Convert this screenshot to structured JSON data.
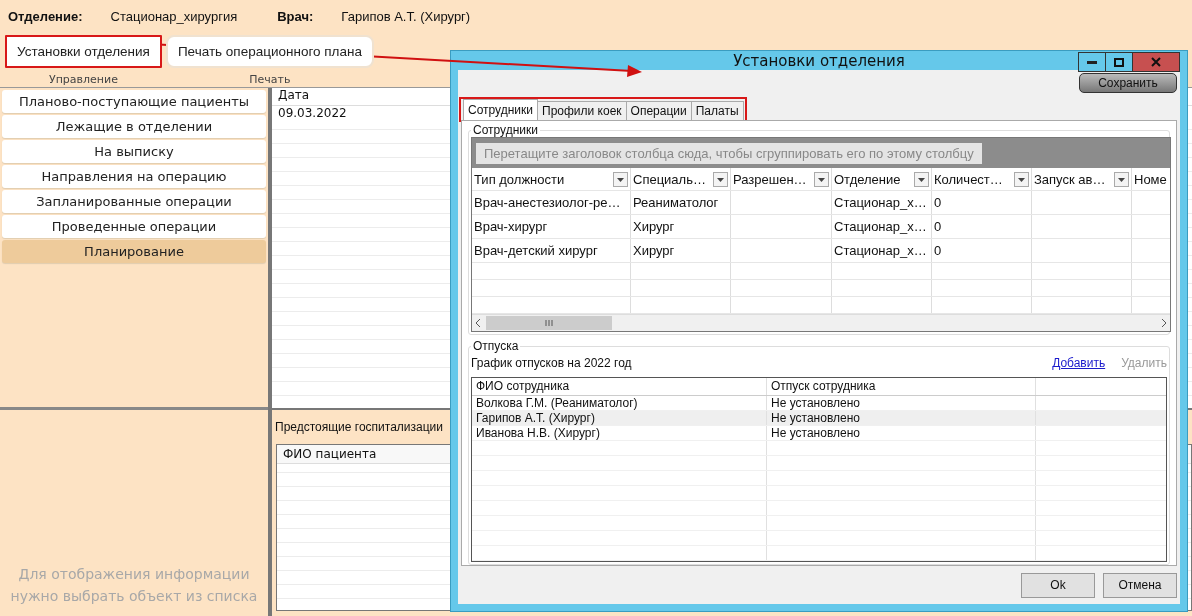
{
  "header": {
    "department_label": "Отделение:",
    "department": "Стационар_хирургия",
    "doctor_label": "Врач:",
    "doctor": "Гарипов А.Т. (Хирург)"
  },
  "ribbon": [
    {
      "group": "Управление",
      "button": "Установки отделения",
      "highlighted": true
    },
    {
      "group": "Печать",
      "button": "Печать операционного плана",
      "highlighted": false
    }
  ],
  "nav": [
    {
      "label": "Планово-поступающие пациенты",
      "selected": false
    },
    {
      "label": "Лежащие в отделении",
      "selected": false
    },
    {
      "label": "На выписку",
      "selected": false
    },
    {
      "label": "Направления на операцию",
      "selected": false
    },
    {
      "label": "Запланированные операции",
      "selected": false
    },
    {
      "label": "Проведенные операции",
      "selected": false
    },
    {
      "label": "Планирование",
      "selected": true
    }
  ],
  "empty_hint": "Для отображения информации нужно выбрать объект из списка",
  "date_grid": {
    "column": "Дата",
    "rows": [
      "09.03.2022"
    ]
  },
  "hospitalizations": {
    "title": "Предстоящие госпитализации",
    "column": "ФИО пациента"
  },
  "dialog": {
    "title": "Установки отделения",
    "save_button": "Сохранить",
    "tabs_highlighted": true,
    "tabs": [
      {
        "label": "Сотрудники",
        "selected": true
      },
      {
        "label": "Профили коек",
        "selected": false
      },
      {
        "label": "Операции",
        "selected": false
      },
      {
        "label": "Палаты",
        "selected": false
      }
    ],
    "staff": {
      "title": "Сотрудники",
      "group_hint": "Перетащите заголовок столбца сюда, чтобы сгруппировать его по этому столбцу",
      "columns": [
        "Тип должности",
        "Специаль…",
        "Разрешен…",
        "Отделение",
        "Количест…",
        "Запуск ав…",
        "Номе"
      ],
      "rows": [
        [
          "Врач-анестезиолог-ре…",
          "Реаниматолог",
          "",
          "Стационар_х…",
          "0",
          "",
          ""
        ],
        [
          "Врач-хирург",
          "Хирург",
          "",
          "Стационар_х…",
          "0",
          "",
          ""
        ],
        [
          "Врач-детский хирург",
          "Хирург",
          "",
          "Стационар_х…",
          "0",
          "",
          ""
        ]
      ]
    },
    "vacations": {
      "title": "Отпуска",
      "caption": "График отпусков на 2022 год",
      "add_link": "Добавить",
      "delete_link": {
        "label": "Удалить",
        "disabled": true
      },
      "columns": [
        "ФИО сотрудника",
        "Отпуск сотрудника"
      ],
      "rows": [
        {
          "cells": [
            "Волкова Г.М. (Реаниматолог)",
            "Не установлено"
          ],
          "selected": false
        },
        {
          "cells": [
            "Гарипов А.Т. (Хирург)",
            "Не установлено"
          ],
          "selected": true
        },
        {
          "cells": [
            "Иванова Н.В. (Хирург)",
            "Не установлено"
          ],
          "selected": false
        }
      ]
    },
    "buttons": [
      "Ok",
      "Отмена"
    ]
  }
}
